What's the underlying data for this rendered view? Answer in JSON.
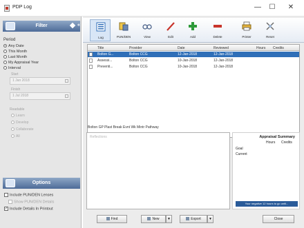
{
  "window": {
    "title": "PDP Log",
    "minimize": "—",
    "maximize": "☐",
    "close": "✕"
  },
  "filter": {
    "header": "Filter",
    "period_label": "Period",
    "options": [
      {
        "label": "Any Date",
        "checked": true
      },
      {
        "label": "This Month",
        "checked": false
      },
      {
        "label": "Last Month",
        "checked": false
      },
      {
        "label": "My Appraisal Year",
        "checked": false
      },
      {
        "label": "Interval",
        "checked": false
      }
    ],
    "start_label": "Start",
    "start_value": "1 Jan 2018",
    "finish_label": "Finish",
    "finish_value": "1 Jul 2018",
    "type_label": "Readable",
    "type_options": [
      "Learn",
      "Develop",
      "Collaborate",
      "All"
    ]
  },
  "options": {
    "header": "Options",
    "items": [
      {
        "label": "Include PUN/DEN Lenses",
        "checked": false,
        "disabled": false
      },
      {
        "label": "Show PUN/DEN Details",
        "checked": false,
        "disabled": true
      },
      {
        "label": "Include Details In Printout",
        "checked": true,
        "disabled": false
      }
    ]
  },
  "toolbar": {
    "buttons": [
      {
        "label": "Log",
        "icon": "log-list-icon",
        "active": true
      },
      {
        "label": "PUN/DEN",
        "icon": "pun-den-icon",
        "active": false
      },
      {
        "label": "View",
        "icon": "view-glasses-icon",
        "active": false
      },
      {
        "label": "Edit",
        "icon": "edit-pencil-icon",
        "active": false
      },
      {
        "label": "Add",
        "icon": "add-plus-icon",
        "active": false
      },
      {
        "label": "Delete",
        "icon": "delete-minus-icon",
        "active": false
      },
      {
        "label": "Printer",
        "icon": "printer-icon",
        "active": false
      },
      {
        "label": "Reset",
        "icon": "reset-icon",
        "active": false
      }
    ],
    "colors": {
      "log": "#2f6fb8",
      "add": "#2e9a3a",
      "delete": "#c8342b",
      "edit": "#c8342b"
    }
  },
  "log_list": {
    "columns": [
      "Title",
      "Provider",
      "Date",
      "Reviewed",
      "Hours",
      "Credits"
    ],
    "rows": [
      {
        "title": "Bolton G...",
        "provider": "Bolton CCG",
        "date": "12-Jan-2018",
        "reviewed": "12-Jan-2018",
        "hours": "",
        "credits": "",
        "selected": true
      },
      {
        "title": "Assessi...",
        "provider": "Bolton CCG",
        "date": "10-Jan-2018",
        "reviewed": "12-Jan-2018",
        "hours": "",
        "credits": "",
        "selected": false
      },
      {
        "title": "Preventi...",
        "provider": "Bolton CCG",
        "date": "10-Jan-2018",
        "reviewed": "12-Jan-2018",
        "hours": "",
        "credits": "",
        "selected": false
      }
    ]
  },
  "notes": {
    "caption": "Bolton GP Plast Break Evnt Wk Mintr Pathway",
    "placeholder": "Reflections"
  },
  "summary": {
    "title": "Appraisal Summary",
    "col_hours": "Hours",
    "col_credits": "Credits",
    "row_goal": "Goal",
    "row_current": "Current",
    "bar_text": "Your negative 12 hours to go until..."
  },
  "bottom": {
    "find": "Find",
    "new": "New",
    "export": "Export",
    "close": "Close"
  }
}
